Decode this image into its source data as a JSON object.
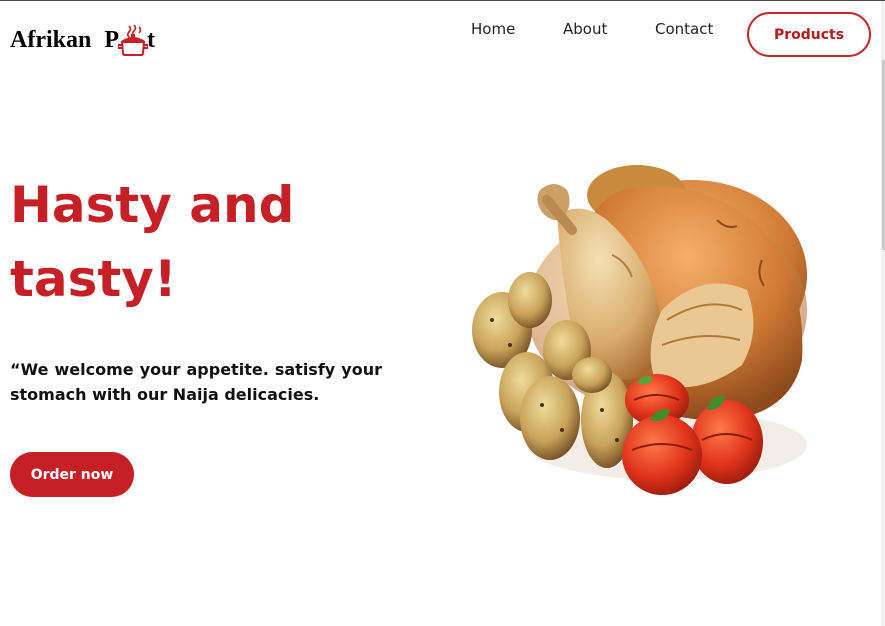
{
  "header": {
    "logo": {
      "word1": "Afrikan",
      "word2_start": "P",
      "word2_end": "t",
      "icon": "cooking-pot-icon"
    },
    "nav": [
      {
        "label": "Home"
      },
      {
        "label": "About"
      },
      {
        "label": "Contact"
      }
    ],
    "products_button": "Products"
  },
  "hero": {
    "title": "Hasty and tasty!",
    "text": "“We welcome your appetite. satisfy your stomach with our Naija delicacies.",
    "order_button": "Order now",
    "image": "roast-chicken-with-potatoes-and-tomatoes"
  },
  "colors": {
    "accent": "#c62026",
    "text": "#111111",
    "background": "#ffffff"
  }
}
